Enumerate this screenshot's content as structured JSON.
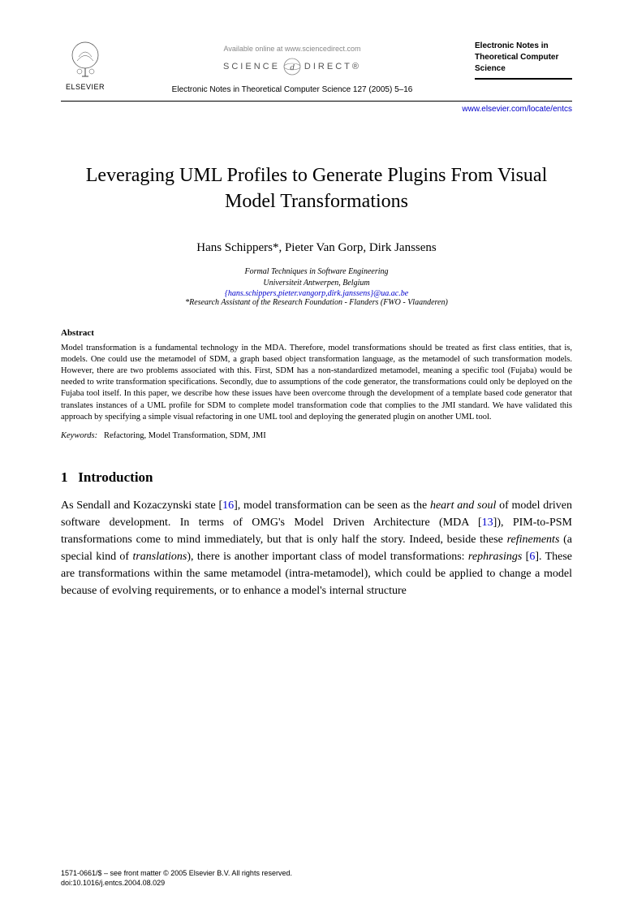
{
  "header": {
    "publisher": "ELSEVIER",
    "available": "Available online at www.sciencedirect.com",
    "sd_left": "SCIENCE",
    "sd_right": "DIRECT®",
    "citation": "Electronic Notes in Theoretical Computer Science 127 (2005) 5–16",
    "journal": "Electronic Notes in Theoretical Computer Science",
    "locate": "www.elsevier.com/locate/entcs"
  },
  "title": "Leveraging UML Profiles to Generate Plugins From Visual Model Transformations",
  "authors": "Hans Schippers*, Pieter Van Gorp, Dirk Janssens",
  "affiliation_line1": "Formal Techniques in Software Engineering",
  "affiliation_line2": "Universiteit Antwerpen, Belgium",
  "email": "{hans.schippers,pieter.vangorp,dirk.janssens}@ua.ac.be",
  "star_note": "*Research Assistant of the Research Foundation - Flanders (FWO - Vlaanderen)",
  "abstract_head": "Abstract",
  "abstract_body": "Model transformation is a fundamental technology in the MDA. Therefore, model transformations should be treated as first class entities, that is, models. One could use the metamodel of SDM, a graph based object transformation language, as the metamodel of such transformation models. However, there are two problems associated with this. First, SDM has a non-standardized metamodel, meaning a specific tool (Fujaba) would be needed to write transformation specifications. Secondly, due to assumptions of the code generator, the transformations could only be deployed on the Fujaba tool itself. In this paper, we describe how these issues have been overcome through the development of a template based code generator that translates instances of a UML profile for SDM to complete model transformation code that complies to the JMI standard. We have validated this approach by specifying a simple visual refactoring in one UML tool and deploying the generated plugin on another UML tool.",
  "keywords_label": "Keywords:",
  "keywords": "Refactoring, Model Transformation, SDM, JMI",
  "section1_num": "1",
  "section1_title": "Introduction",
  "body_p1_a": "As Sendall and Kozaczynski state [",
  "cite16": "16",
  "body_p1_b": "], model transformation can be seen as the ",
  "body_p1_c": "heart and soul",
  "body_p1_d": " of model driven software development. In terms of OMG's Model Driven Architecture (MDA [",
  "cite13": "13",
  "body_p1_e": "]), PIM-to-PSM transformations come to mind immediately, but that is only half the story. Indeed, beside these ",
  "body_p1_f": "refinements",
  "body_p1_g": " (a special kind of ",
  "body_p1_h": "translations",
  "body_p1_i": "), there is another important class of model transformations: ",
  "body_p1_j": "rephrasings",
  "body_p1_k": " [",
  "cite6": "6",
  "body_p1_l": "]. These are transformations within the same metamodel (intra-metamodel), which could be applied to change a model because of evolving requirements, or to enhance a model's internal structure",
  "footer_line1": "1571-0661/$ – see front matter © 2005 Elsevier B.V. All rights reserved.",
  "footer_line2": "doi:10.1016/j.entcs.2004.08.029"
}
